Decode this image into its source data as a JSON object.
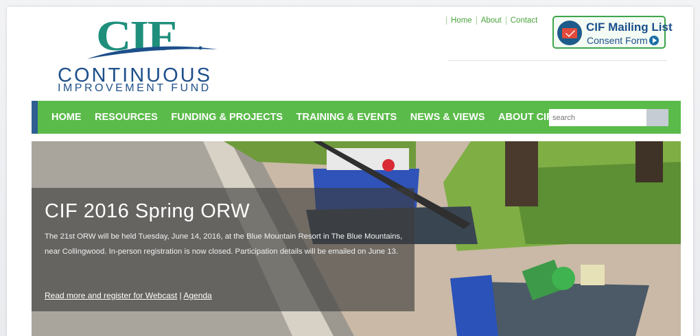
{
  "logo": {
    "mark": "CIF",
    "line1": "CONTINUOUS",
    "line2": "IMPROVEMENT FUND"
  },
  "top_links": [
    "Home",
    "About",
    "Contact"
  ],
  "mailing": {
    "title": "CIF Mailing List",
    "subtitle": "Consent Form",
    "icon": "envelope-icon"
  },
  "nav": {
    "items": [
      "HOME",
      "RESOURCES",
      "FUNDING & PROJECTS",
      "TRAINING & EVENTS",
      "NEWS & VIEWS",
      "ABOUT CIF"
    ],
    "search_placeholder": "search"
  },
  "hero": {
    "title": "CIF 2016 Spring ORW",
    "body": "The 21st ORW will be held Tuesday, June 14, 2016, at the Blue Mountain Resort in The Blue Mountains, near Collingwood. In-person registration is now closed. Participation details will be emailed on June 13.",
    "link1": "Read more and register for Webcast",
    "separator": "|",
    "link2": "Agenda"
  },
  "colors": {
    "nav_green": "#5bbb4a",
    "nav_accent": "#2f5f92",
    "logo_teal": "#1f8f7c",
    "logo_blue": "#1d4f8a"
  }
}
